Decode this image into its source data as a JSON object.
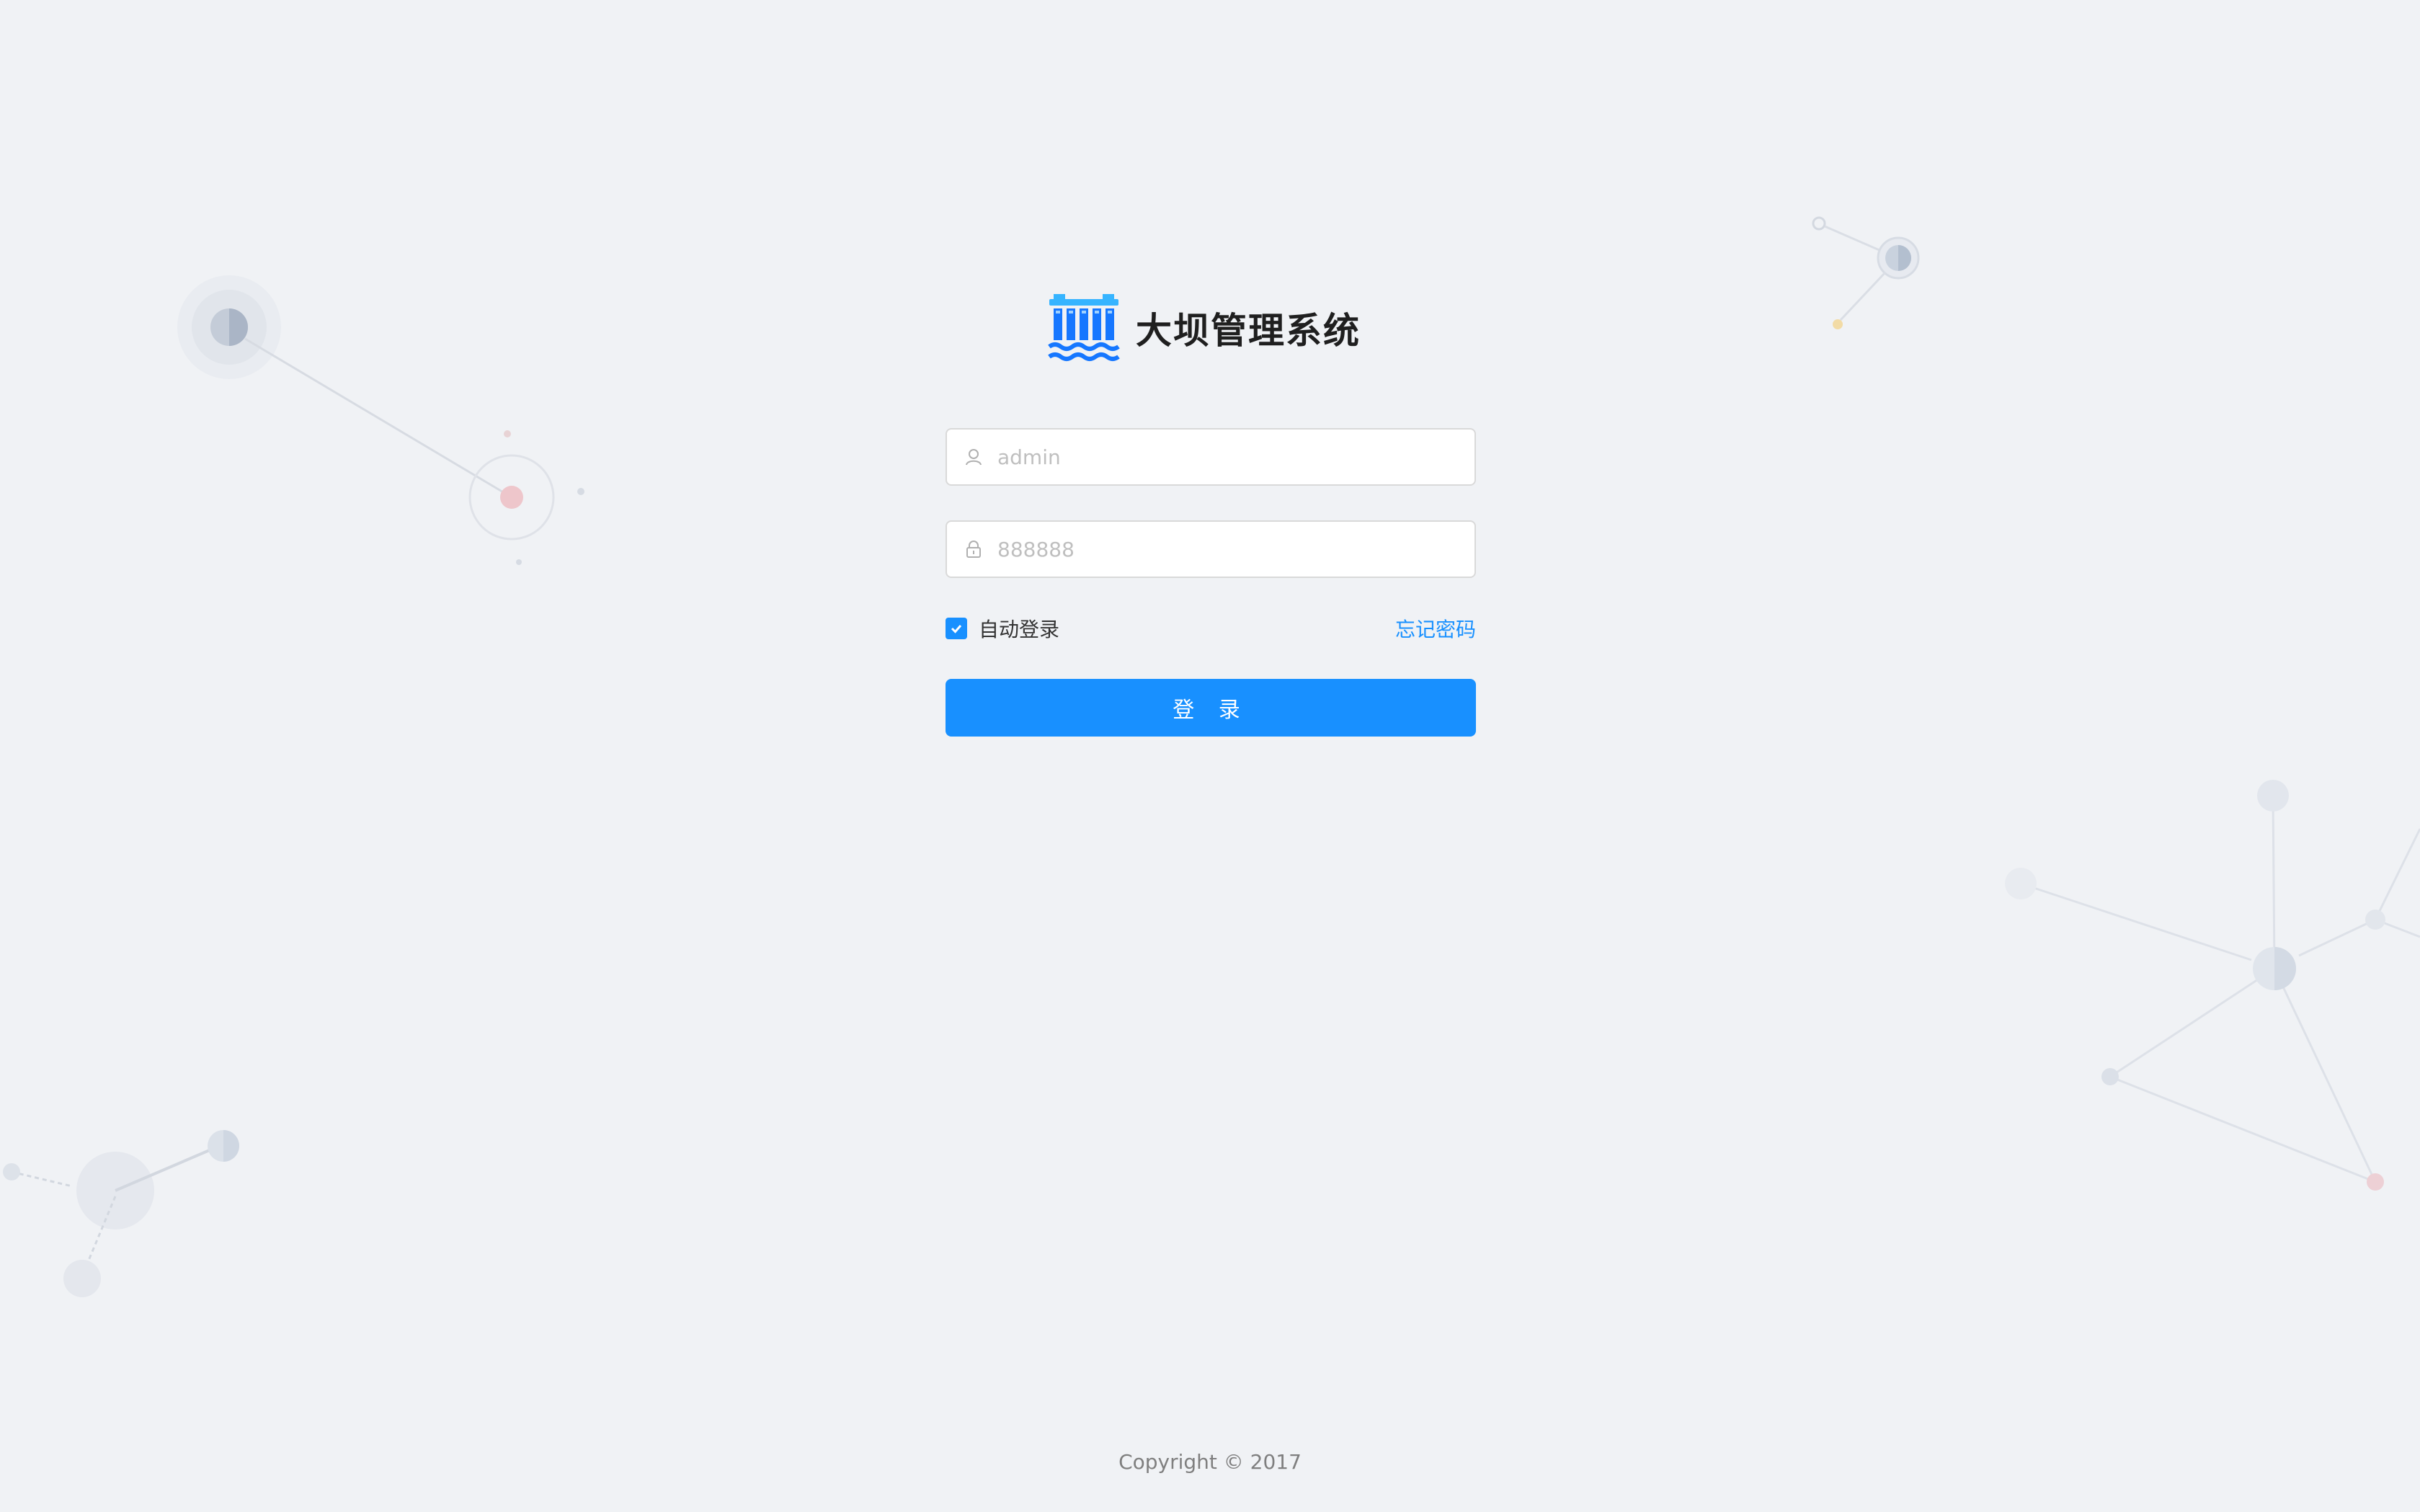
{
  "brand": {
    "title": "大坝管理系统",
    "logo_icon": "dam-icon",
    "logo_colors": {
      "primary": "#1677ff",
      "accent": "#36b4ff"
    }
  },
  "login_form": {
    "username": {
      "value": "",
      "placeholder": "admin",
      "icon": "user-icon"
    },
    "password": {
      "value": "",
      "placeholder": "888888",
      "icon": "lock-icon"
    },
    "auto_login": {
      "label": "自动登录",
      "checked": true
    },
    "forgot_password_label": "忘记密码",
    "submit_label": "登 录"
  },
  "footer": {
    "copyright": "Copyright © 2017"
  },
  "colors": {
    "background": "#f0f2f5",
    "primary": "#1890ff",
    "text": "#333333",
    "muted": "#7f7f7f"
  }
}
